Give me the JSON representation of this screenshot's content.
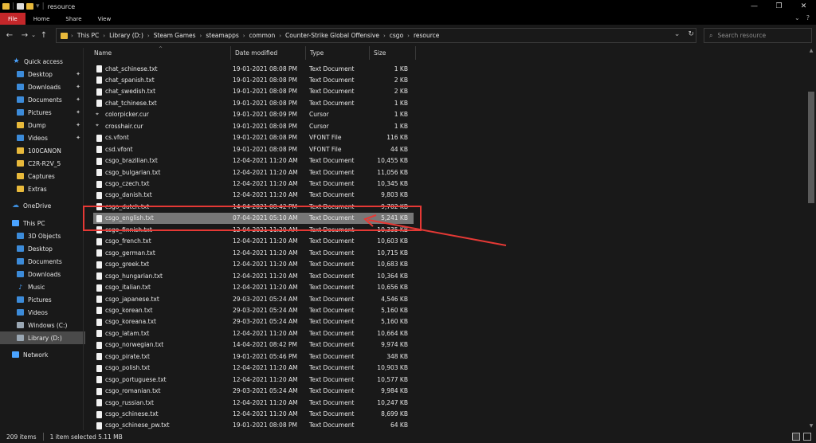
{
  "window": {
    "title": "resource",
    "controls": {
      "minimize": "—",
      "maximize": "❐",
      "close": "✕"
    }
  },
  "ribbon": {
    "tabs": [
      "File",
      "Home",
      "Share",
      "View"
    ],
    "collapse": "⌄",
    "help": "?"
  },
  "address": {
    "breadcrumbs": [
      "This PC",
      "Library (D:)",
      "Steam Games",
      "steamapps",
      "common",
      "Counter-Strike Global Offensive",
      "csgo",
      "resource"
    ],
    "separator": "›",
    "search_placeholder": "Search resource"
  },
  "nav": {
    "items": [
      {
        "label": "Quick access",
        "icon": "star-icon",
        "pinned": false
      },
      {
        "label": "Desktop",
        "icon": "desktop-icon",
        "pinned": true
      },
      {
        "label": "Downloads",
        "icon": "downloads-icon",
        "pinned": true
      },
      {
        "label": "Documents",
        "icon": "documents-icon",
        "pinned": true
      },
      {
        "label": "Pictures",
        "icon": "pictures-icon",
        "pinned": true
      },
      {
        "label": "Dump",
        "icon": "folder-icon",
        "pinned": true
      },
      {
        "label": "Videos",
        "icon": "videos-icon",
        "pinned": true
      },
      {
        "label": "100CANON",
        "icon": "folder-icon",
        "pinned": false
      },
      {
        "label": "C2R-R2V_5",
        "icon": "folder-icon",
        "pinned": false
      },
      {
        "label": "Captures",
        "icon": "folder-icon",
        "pinned": false
      },
      {
        "label": "Extras",
        "icon": "folder-icon",
        "pinned": false
      },
      {
        "label": "OneDrive",
        "icon": "cloud-icon",
        "pinned": false
      },
      {
        "label": "This PC",
        "icon": "pc-icon",
        "pinned": false
      },
      {
        "label": "3D Objects",
        "icon": "3d-objects-icon",
        "pinned": false
      },
      {
        "label": "Desktop",
        "icon": "desktop-icon",
        "pinned": false
      },
      {
        "label": "Documents",
        "icon": "documents-icon",
        "pinned": false
      },
      {
        "label": "Downloads",
        "icon": "downloads-icon",
        "pinned": false
      },
      {
        "label": "Music",
        "icon": "music-icon",
        "pinned": false
      },
      {
        "label": "Pictures",
        "icon": "pictures-icon",
        "pinned": false
      },
      {
        "label": "Videos",
        "icon": "videos-icon",
        "pinned": false
      },
      {
        "label": "Windows (C:)",
        "icon": "drive-icon",
        "pinned": false
      },
      {
        "label": "Library (D:)",
        "icon": "drive-icon",
        "pinned": false,
        "selected": true
      },
      {
        "label": "Network",
        "icon": "network-icon",
        "pinned": false
      }
    ]
  },
  "columns": {
    "name": "Name",
    "date": "Date modified",
    "type": "Type",
    "size": "Size"
  },
  "files": [
    {
      "name": "chat_schinese.txt",
      "date": "19-01-2021 08:08 PM",
      "type": "Text Document",
      "size": "1 KB"
    },
    {
      "name": "chat_spanish.txt",
      "date": "19-01-2021 08:08 PM",
      "type": "Text Document",
      "size": "2 KB"
    },
    {
      "name": "chat_swedish.txt",
      "date": "19-01-2021 08:08 PM",
      "type": "Text Document",
      "size": "2 KB"
    },
    {
      "name": "chat_tchinese.txt",
      "date": "19-01-2021 08:08 PM",
      "type": "Text Document",
      "size": "1 KB"
    },
    {
      "name": "colorpicker.cur",
      "date": "19-01-2021 08:09 PM",
      "type": "Cursor",
      "size": "1 KB"
    },
    {
      "name": "crosshair.cur",
      "date": "19-01-2021 08:08 PM",
      "type": "Cursor",
      "size": "1 KB"
    },
    {
      "name": "cs.vfont",
      "date": "19-01-2021 08:08 PM",
      "type": "VFONT File",
      "size": "116 KB"
    },
    {
      "name": "csd.vfont",
      "date": "19-01-2021 08:08 PM",
      "type": "VFONT File",
      "size": "44 KB"
    },
    {
      "name": "csgo_brazilian.txt",
      "date": "12-04-2021 11:20 AM",
      "type": "Text Document",
      "size": "10,455 KB"
    },
    {
      "name": "csgo_bulgarian.txt",
      "date": "12-04-2021 11:20 AM",
      "type": "Text Document",
      "size": "11,056 KB"
    },
    {
      "name": "csgo_czech.txt",
      "date": "12-04-2021 11:20 AM",
      "type": "Text Document",
      "size": "10,345 KB"
    },
    {
      "name": "csgo_danish.txt",
      "date": "12-04-2021 11:20 AM",
      "type": "Text Document",
      "size": "9,803 KB"
    },
    {
      "name": "csgo_dutch.txt",
      "date": "14-04-2021 08:42 PM",
      "type": "Text Document",
      "size": "9,702 KB"
    },
    {
      "name": "csgo_english.txt",
      "date": "07-04-2021 05:10 AM",
      "type": "Text Document",
      "size": "5,241 KB",
      "selected": true
    },
    {
      "name": "csgo_finnish.txt",
      "date": "12-04-2021 11:20 AM",
      "type": "Text Document",
      "size": "10,335 KB"
    },
    {
      "name": "csgo_french.txt",
      "date": "12-04-2021 11:20 AM",
      "type": "Text Document",
      "size": "10,603 KB"
    },
    {
      "name": "csgo_german.txt",
      "date": "12-04-2021 11:20 AM",
      "type": "Text Document",
      "size": "10,715 KB"
    },
    {
      "name": "csgo_greek.txt",
      "date": "12-04-2021 11:20 AM",
      "type": "Text Document",
      "size": "10,683 KB"
    },
    {
      "name": "csgo_hungarian.txt",
      "date": "12-04-2021 11:20 AM",
      "type": "Text Document",
      "size": "10,364 KB"
    },
    {
      "name": "csgo_italian.txt",
      "date": "12-04-2021 11:20 AM",
      "type": "Text Document",
      "size": "10,656 KB"
    },
    {
      "name": "csgo_japanese.txt",
      "date": "29-03-2021 05:24 AM",
      "type": "Text Document",
      "size": "4,546 KB"
    },
    {
      "name": "csgo_korean.txt",
      "date": "29-03-2021 05:24 AM",
      "type": "Text Document",
      "size": "5,160 KB"
    },
    {
      "name": "csgo_koreana.txt",
      "date": "29-03-2021 05:24 AM",
      "type": "Text Document",
      "size": "5,160 KB"
    },
    {
      "name": "csgo_latam.txt",
      "date": "12-04-2021 11:20 AM",
      "type": "Text Document",
      "size": "10,664 KB"
    },
    {
      "name": "csgo_norwegian.txt",
      "date": "14-04-2021 08:42 PM",
      "type": "Text Document",
      "size": "9,974 KB"
    },
    {
      "name": "csgo_pirate.txt",
      "date": "19-01-2021 05:46 PM",
      "type": "Text Document",
      "size": "348 KB"
    },
    {
      "name": "csgo_polish.txt",
      "date": "12-04-2021 11:20 AM",
      "type": "Text Document",
      "size": "10,903 KB"
    },
    {
      "name": "csgo_portuguese.txt",
      "date": "12-04-2021 11:20 AM",
      "type": "Text Document",
      "size": "10,577 KB"
    },
    {
      "name": "csgo_romanian.txt",
      "date": "29-03-2021 05:24 AM",
      "type": "Text Document",
      "size": "9,984 KB"
    },
    {
      "name": "csgo_russian.txt",
      "date": "12-04-2021 11:20 AM",
      "type": "Text Document",
      "size": "10,247 KB"
    },
    {
      "name": "csgo_schinese.txt",
      "date": "12-04-2021 11:20 AM",
      "type": "Text Document",
      "size": "8,699 KB"
    },
    {
      "name": "csgo_schinese_pw.txt",
      "date": "19-01-2021 08:08 PM",
      "type": "Text Document",
      "size": "64 KB"
    }
  ],
  "status": {
    "items_count": "209 items",
    "selection": "1 item selected  5.11 MB"
  },
  "colors": {
    "accent_file_tab": "#c4272a",
    "annotation": "#e53935",
    "selected_row": "#777777",
    "background": "#191919"
  }
}
